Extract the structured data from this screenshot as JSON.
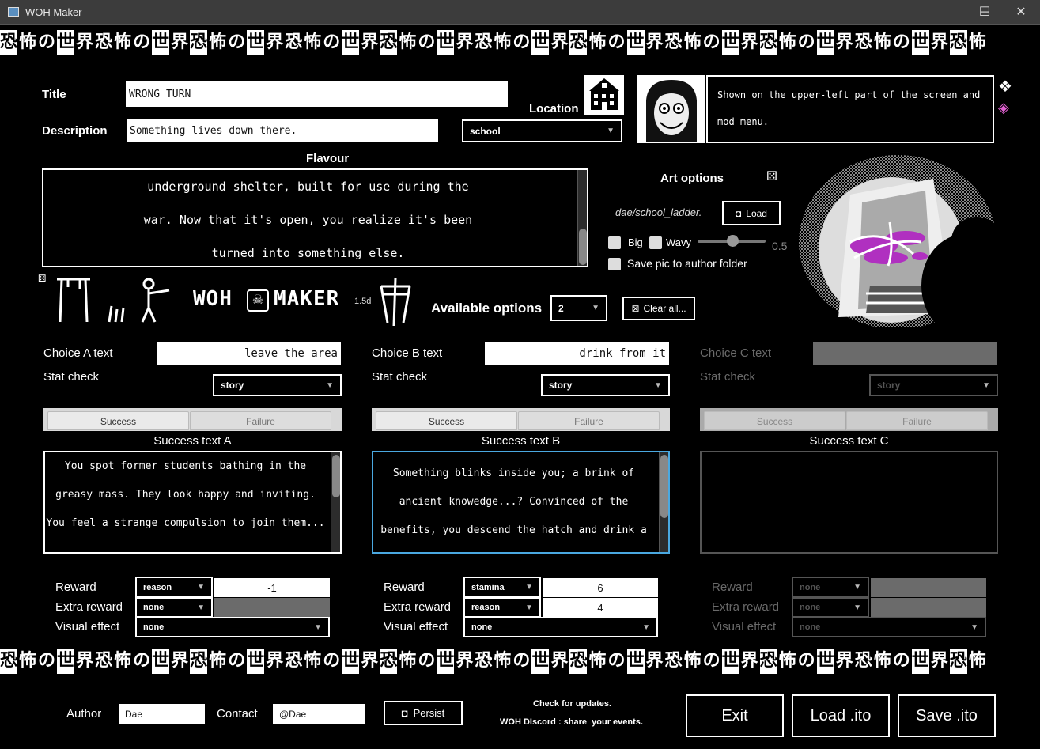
{
  "window": {
    "title": "WOH Maker",
    "minimize_glyph": "─",
    "maximize_glyph": "☐",
    "close_glyph": "✕"
  },
  "banner": {
    "glyphs": [
      "恐",
      "怖",
      "の",
      "世",
      "界",
      "恐",
      "怖",
      "の",
      "世",
      "界",
      "恐",
      "怖",
      "の",
      "世",
      "界",
      "恐",
      "怖",
      "の",
      "世",
      "界",
      "恐",
      "怖",
      "の",
      "世",
      "界",
      "恐",
      "怖",
      "の",
      "世",
      "界",
      "恐",
      "怖",
      "の",
      "世",
      "界",
      "恐",
      "怖",
      "の",
      "世",
      "界",
      "恐",
      "怖",
      "の",
      "世",
      "界",
      "恐",
      "怖",
      "の",
      "世",
      "界",
      "恐",
      "怖"
    ]
  },
  "event": {
    "title_label": "Title",
    "title_value": "WRONG TURN",
    "description_label": "Description",
    "description_value": "Something lives down there.",
    "location_label": "Location",
    "location_value": "school",
    "hint_text": "Shown on the upper-left part of the screen and mod menu.",
    "flavour_label": "Flavour",
    "flavour_lines": [
      "underground shelter, built for use during the",
      "war. Now that it's open, you realize it's been",
      "turned into something else."
    ]
  },
  "art": {
    "label": "Art options",
    "path_value": "dae/school_ladder.",
    "load_label": "Load",
    "big_label": "Big",
    "wavy_label": "Wavy",
    "slider_value": "0.5",
    "save_pic_label": "Save pic to author folder"
  },
  "branding": {
    "logo_left": "WOH",
    "logo_right": "MAKER",
    "version": "1.5d"
  },
  "options": {
    "available_label": "Available options",
    "available_value": "2",
    "clear_label": "Clear all..."
  },
  "choices": [
    {
      "text_label": "Choice A text",
      "text_value": "leave the area",
      "stat_label": "Stat check",
      "stat_value": "story",
      "tab_success": "Success",
      "tab_failure": "Failure",
      "success_title": "Success text A",
      "success_lines": [
        "You spot former students bathing in the",
        "greasy mass. They look happy and inviting.",
        "You feel a strange compulsion to join them..."
      ],
      "reward_label": "Reward",
      "reward_value": "reason",
      "reward_amount": "-1",
      "extra_label": "Extra reward",
      "extra_value": "none",
      "extra_amount": "",
      "visual_label": "Visual effect",
      "visual_value": "none"
    },
    {
      "text_label": "Choice B text",
      "text_value": "drink from it",
      "stat_label": "Stat check",
      "stat_value": "story",
      "tab_success": "Success",
      "tab_failure": "Failure",
      "success_title": "Success text B",
      "success_lines": [
        "Something blinks inside you; a brink of",
        "ancient knowedge...? Convinced of the",
        "benefits, you descend the hatch and drink a"
      ],
      "reward_label": "Reward",
      "reward_value": "stamina",
      "reward_amount": "6",
      "extra_label": "Extra reward",
      "extra_value": "reason",
      "extra_amount": "4",
      "visual_label": "Visual effect",
      "visual_value": "none"
    },
    {
      "text_label": "Choice C text",
      "text_value": "",
      "stat_label": "Stat check",
      "stat_value": "story",
      "tab_success": "Success",
      "tab_failure": "Failure",
      "success_title": "Success text C",
      "success_lines": [],
      "reward_label": "Reward",
      "reward_value": "none",
      "reward_amount": "",
      "extra_label": "Extra reward",
      "extra_value": "none",
      "extra_amount": "",
      "visual_label": "Visual effect",
      "visual_value": "none"
    }
  ],
  "footer": {
    "author_label": "Author",
    "author_value": "Dae",
    "contact_label": "Contact",
    "contact_value": "@Dae",
    "persist_label": "Persist",
    "updates_text": "Check for updates.",
    "discord_text": "WOH DIscord : share  your events.",
    "exit_label": "Exit",
    "load_label": "Load .ito",
    "save_label": "Save .ito"
  }
}
